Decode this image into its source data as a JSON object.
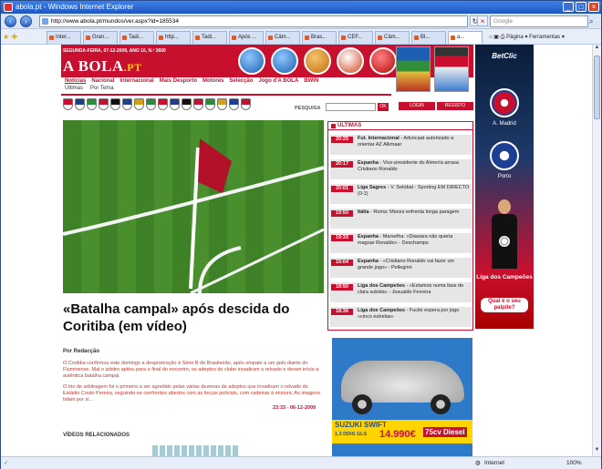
{
  "window": {
    "title": "abola.pt - Windows Internet Explorer"
  },
  "addressbar": {
    "url": "http://www.abola.pt/mundos/ver.aspx?id=185534",
    "search_placeholder": "Google"
  },
  "tabs": [
    "Inter...",
    "Gran...",
    "Tadi...",
    "http...",
    "Tadi...",
    "Após ...",
    "Câm...",
    "Bras...",
    "CEF...",
    "Câm...",
    "Bl...",
    "a..."
  ],
  "commands": {
    "page": "Página",
    "tools": "Ferramentas"
  },
  "site": {
    "date_line": "SEGUNDA-FEIRA, 07-12-2009, ANO 10, N.º 3600",
    "logo_main": "A BOLA",
    "logo_suffix": ".PT",
    "nav_primary": [
      "Notícias",
      "Nacional",
      "Internacional",
      "Mais Desporto",
      "Motores",
      "Selecção",
      "Jogo d'A BOLA",
      "BWIN"
    ],
    "nav_secondary": [
      "Últimas",
      "Por Tema"
    ],
    "search_label": "PESQUISA",
    "search_ok": "OK",
    "login": "LOGIN",
    "register": "REGISTO"
  },
  "article": {
    "headline": "«Batalha campal» após descida do Coritiba (em vídeo)",
    "author": "Por Redacção",
    "p1": "O Coritiba confirmou este domingo a despromoção à Série B do Brasileirão, após empate a um golo diante do Fluminense. Mal o árbitro apitou para o final do encontro, os adeptos do clube invadiram o relvado e deram início a autêntica batalha campal.",
    "p2": "O trio de arbitragem foi o primeiro a ser agredido pelas várias dezenas de adeptos que invadiram o relvado do Estádio Couto Pereira, seguindo-se confrontos abertos com as forças policiais, com cadeiras à mistura. As imagens falam por si...",
    "timestamp": "23:33 - 06-12-2009",
    "videos_heading": "VÍDEOS RELACIONADOS"
  },
  "latest": {
    "heading": "ÚLTIMAS",
    "items": [
      {
        "time": "20:25",
        "cat": "Fut. Internacional",
        "text": " - Advocaat autorizado a orientar AZ Alkmaar"
      },
      {
        "time": "20:17",
        "cat": "Espanha",
        "text": " - Vice-presidente do Almería arrasa Cristiano Ronaldo"
      },
      {
        "time": "20:01",
        "cat": "Liga Sagres",
        "text": " - V. Setúbal - Sporting EM DIRECTO (0-1)"
      },
      {
        "time": "19:50",
        "cat": "Itália",
        "text": " - Roma: Mexes enfrenta longa paragem"
      },
      {
        "time": "19:33",
        "cat": "Espanha",
        "text": " - Marselha: «Diawara não queria magoar Ronaldo» - Deschamps"
      },
      {
        "time": "19:04",
        "cat": "Espanha",
        "text": " - «Cristiano Ronaldo vai fazer um grande jogo» - Pellegrini"
      },
      {
        "time": "18:50",
        "cat": "Liga dos Campeões",
        "text": " - «Estamos numa fase de clara subida» - Jesualdo Ferreira"
      },
      {
        "time": "18:36",
        "cat": "Liga dos Campeões",
        "text": " - Fucile espera por jogo «cinco estrelas»"
      }
    ]
  },
  "ad": {
    "brand": "SUZUKI SWIFT",
    "price": "14.990€",
    "engine": "1.3 DDiS GLS",
    "power": "75cv Diesel"
  },
  "betclic": {
    "logo": "BetClic",
    "club1": "A. Madrid",
    "club2": "Porto",
    "cta_title": "Liga dos Campeões",
    "cta_button": "Qual é o seu palpite?"
  },
  "status": {
    "zone": "Internet",
    "zoom": "100%"
  },
  "colors": {
    "brand_red": "#c8102e",
    "ie_blue": "#1f55c4"
  }
}
